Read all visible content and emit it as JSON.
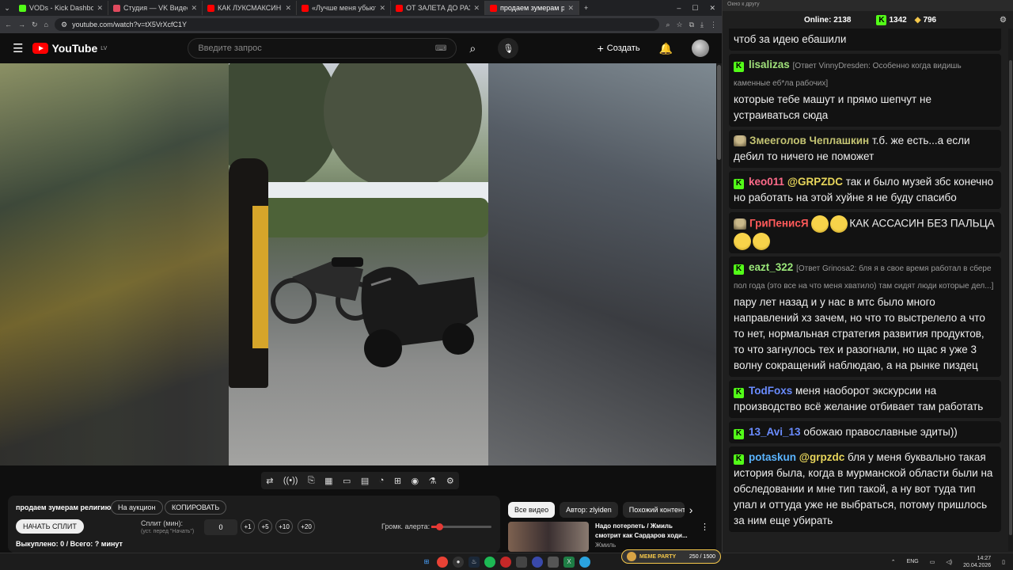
{
  "tabs": [
    {
      "label": "VODs - Kick Dashboard",
      "color": "#53fc18"
    },
    {
      "label": "Студия — VK Видео Live",
      "color": "#e04a5e"
    },
    {
      "label": "КАК ЛУКСМАКСИНГ СДЕЛАЛ",
      "color": "#ff0000"
    },
    {
      "label": "«Лучше меня убьют, чем на н",
      "color": "#ff0000"
    },
    {
      "label": "ОТ ЗАЛЕТА ДО РАЗВОДА: пон",
      "color": "#ff0000"
    },
    {
      "label": "продаем зумерам религи",
      "color": "#ff0000",
      "active": true
    }
  ],
  "address": "youtube.com/watch?v=tX5VrXcfC1Y",
  "youtube": {
    "logo": "YouTube",
    "region": "LV",
    "search_placeholder": "Введите запрос",
    "create_label": "Создать"
  },
  "control_icons": [
    "repeat-icon",
    "live-icon",
    "clip-icon",
    "film-icon",
    "miniplayer-icon",
    "theater-icon",
    "speed-icon",
    "add-icon",
    "screenshot-icon",
    "lab-icon",
    "settings-icon"
  ],
  "panel": {
    "title": "продаем зумерам религию",
    "auction_label": "На аукцион",
    "copy_label": "КОПИРОВАТЬ",
    "start_split_label": "НАЧАТЬ СПЛИТ",
    "split_label": "Сплит (мин):",
    "split_hint": "(уст. перед \"Начать\")",
    "split_value": "0",
    "increments": [
      "+1",
      "+5",
      "+10",
      "+20"
    ],
    "alert_volume_label": "Громк. алерта:",
    "alert_volume": 0.1,
    "bought_label": "Выкуплено: 0 / Всего: ? минут"
  },
  "chips": [
    "Все видео",
    "Автор: zlyiden",
    "Похожий контент"
  ],
  "recommendation": {
    "title": "Надо потерпеть / Жмиль смотрит как Сардаров ходи...",
    "channel": "Жмиль"
  },
  "chat": {
    "window_title": "Окно к другу",
    "online_label": "Online:",
    "online_count": "2138",
    "kick_count": "1342",
    "gold_count": "796",
    "partial_top": "чтоб за идею ебашили",
    "messages": [
      {
        "user": "lisalizas",
        "color": "#a0e07a",
        "badge": "kick",
        "reply": "[Ответ VinnyDresden: Особенно когда видишь каменные еб*ла рабочих]",
        "text": "которые тебе машут и прямо шепчут не устраиваться сюда"
      },
      {
        "user": "Змееголов Чеплашкин",
        "color": "#c4c473",
        "badge": "avatar",
        "text": "т.б. же есть...а если дебил то ничего не поможет"
      },
      {
        "user": "keo011",
        "color": "#ff6b8a",
        "badge": "kick",
        "mention": "@GRPZDC",
        "text": "так и было музей збс конечно но работать на этой хуйне я не буду спасибо"
      },
      {
        "user": "ГриПенисЯ",
        "color": "#ff5a5a",
        "badge": "avatar",
        "text": "КАК АССАСИН БЕЗ ПАЛЬЦА",
        "emotes_before": 2,
        "emotes_after": 2
      },
      {
        "user": "eazt_322",
        "color": "#9be87a",
        "badge": "kick",
        "reply": "[Ответ Grinosa2: бля я в свое время работал в сбере пол года (это все на что меня хватило) там сидят люди которые дел...]",
        "text": "пару лет назад и у нас в мтс было много направлений хз зачем, но что то выстрелело а что то нет, нормальная стратегия развития продуктов, то что загнулось тех и разогнали, но щас я уже 3 волну сокращений наблюдаю, а на рынке пиздец"
      },
      {
        "user": "TodFoxs",
        "color": "#6a8cff",
        "badge": "kick",
        "text": "меня наоборот экскурсии на производство всё желание отбивает там работать"
      },
      {
        "user": "13_Avi_13",
        "color": "#6a8cff",
        "badge": "kick",
        "text": "обожаю православные эдиты))"
      },
      {
        "user": "potaskun",
        "color": "#5ab4ff",
        "badge": "kick",
        "mention": "@grpzdc",
        "text": "бля у меня буквально такая история была, когда в мурманской области были на обследовании и мне тип такой, а ну вот туда тип упал и оттуда уже не выбраться, потому пришлось за ним еще убирать"
      }
    ]
  },
  "taskbar": {
    "meme_label": "MEME PARTY",
    "meme_progress": "250 / 1500",
    "lang": "ENG",
    "time": "14:27",
    "date": "20.04.2026"
  }
}
